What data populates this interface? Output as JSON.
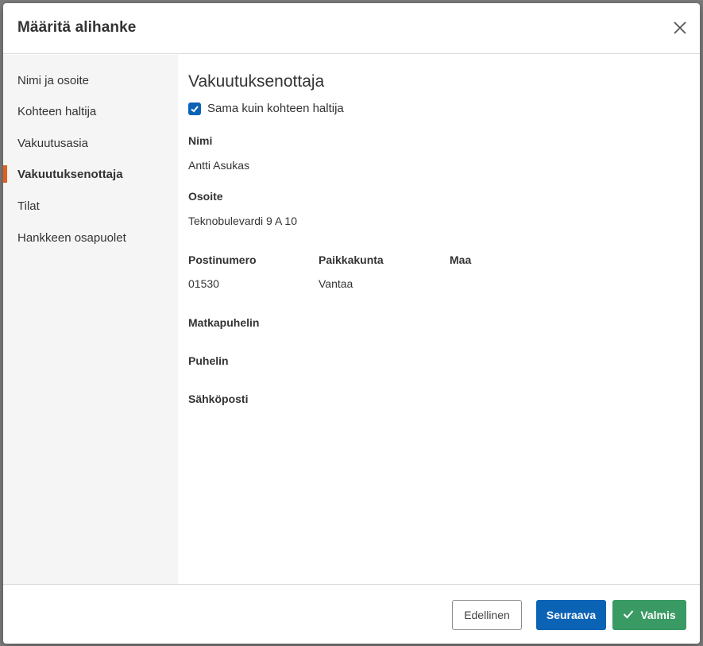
{
  "modal": {
    "title": "Määritä alihanke"
  },
  "sidebar": {
    "items": [
      {
        "label": "Nimi ja osoite"
      },
      {
        "label": "Kohteen haltija"
      },
      {
        "label": "Vakuutusasia"
      },
      {
        "label": "Vakuutuksenottaja",
        "active": true
      },
      {
        "label": "Tilat"
      },
      {
        "label": "Hankkeen osapuolet"
      }
    ]
  },
  "form": {
    "section_title": "Vakuutuksenottaja",
    "same_as_holder": {
      "label": "Sama kuin kohteen haltija",
      "checked": true
    },
    "name": {
      "label": "Nimi",
      "value": "Antti Asukas"
    },
    "address": {
      "label": "Osoite",
      "value": "Teknobulevardi 9 A 10"
    },
    "postal_code": {
      "label": "Postinumero",
      "value": "01530"
    },
    "city": {
      "label": "Paikkakunta",
      "value": "Vantaa"
    },
    "country": {
      "label": "Maa",
      "value": ""
    },
    "mobile": {
      "label": "Matkapuhelin",
      "value": ""
    },
    "phone": {
      "label": "Puhelin",
      "value": ""
    },
    "email": {
      "label": "Sähköposti",
      "value": ""
    }
  },
  "footer": {
    "prev_label": "Edellinen",
    "next_label": "Seuraava",
    "done_label": "Valmis"
  },
  "colors": {
    "accent_active": "#e0601e",
    "primary": "#0b63b5",
    "success": "#3a9a63"
  },
  "icons": {
    "close": "close-icon",
    "checkbox": "checkmark-icon",
    "done": "check-icon"
  }
}
